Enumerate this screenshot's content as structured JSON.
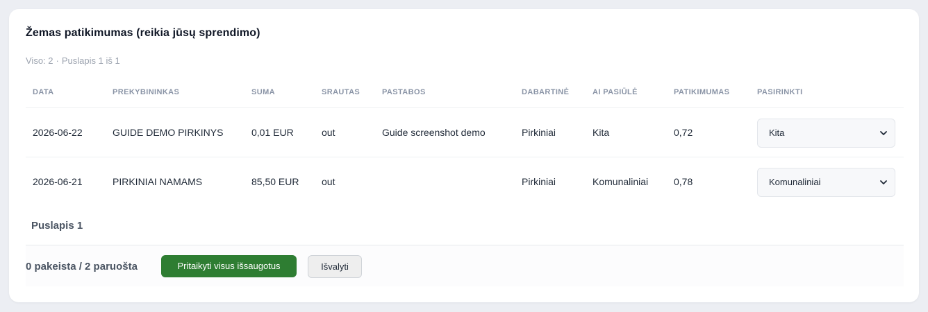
{
  "section": {
    "title": "Žemas patikimumas (reikia jūsų sprendimo)",
    "total": "Viso: 2",
    "separator": "·",
    "page_info": "Puslapis 1 iš 1"
  },
  "table": {
    "headers": [
      "DATA",
      "PREKYBININKAS",
      "SUMA",
      "SRAUTAS",
      "PASTABOS",
      "DABARTINĖ",
      "AI PASIŪLĖ",
      "PATIKIMUMAS",
      "PASIRINKTI"
    ],
    "rows": [
      {
        "date": "2026-06-22",
        "merchant": "GUIDE DEMO PIRKINYS",
        "amount": "0,01 EUR",
        "flow": "out",
        "notes": "Guide screenshot demo",
        "current": "Pirkiniai",
        "ai_suggestion": "Kita",
        "confidence": "0,72",
        "selected": "Kita"
      },
      {
        "date": "2026-06-21",
        "merchant": "PIRKINIAI NAMAMS",
        "amount": "85,50 EUR",
        "flow": "out",
        "notes": "",
        "current": "Pirkiniai",
        "ai_suggestion": "Komunaliniai",
        "confidence": "0,78",
        "selected": "Komunaliniai"
      }
    ]
  },
  "pager": {
    "label": "Puslapis 1"
  },
  "footer": {
    "counts": "0 pakeista / 2 paruošta",
    "apply_label": "Pritaikyti visus išsaugotus",
    "clear_label": "Išvalyti"
  },
  "colors": {
    "accent": "#2e7d32",
    "muted": "#9ca3af",
    "background": "#eceef3"
  },
  "icons": {
    "select_chevron": "chevron-down-icon"
  }
}
